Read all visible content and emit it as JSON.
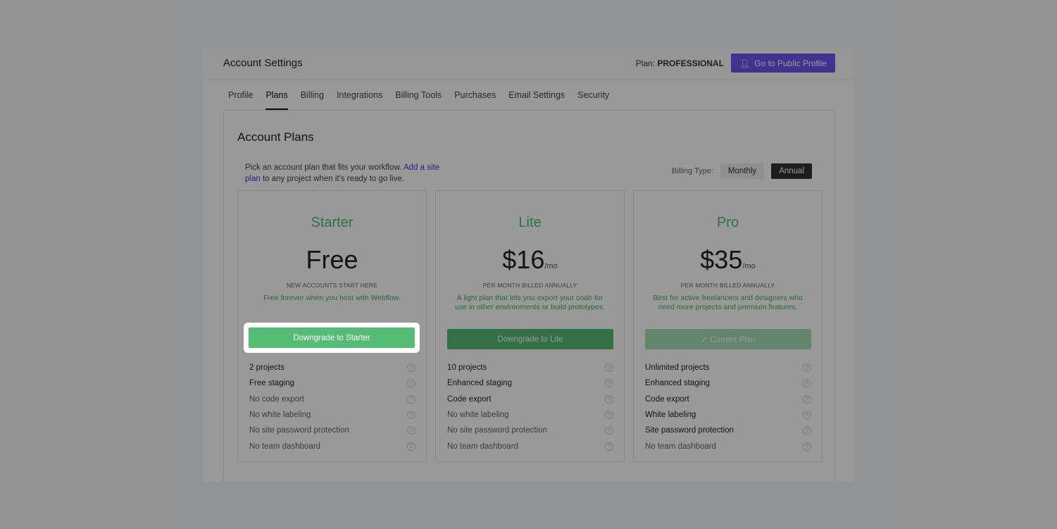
{
  "header": {
    "title": "Account Settings",
    "plan_label": "Plan:",
    "plan_value": "PROFESSIONAL",
    "profile_button": "Go to Public Profile"
  },
  "tabs": [
    "Profile",
    "Plans",
    "Billing",
    "Integrations",
    "Billing Tools",
    "Purchases",
    "Email Settings",
    "Security"
  ],
  "active_tab": "Plans",
  "section": {
    "title": "Account Plans",
    "desc_before": "Pick an account plan that fits your workflow. ",
    "desc_link": "Add a site plan",
    "desc_after": " to any project when it's ready to go live.",
    "billing_label": "Billing Type:",
    "billing_options": [
      "Monthly",
      "Annual"
    ],
    "billing_selected": "Annual"
  },
  "plans": [
    {
      "name": "Starter",
      "price": "Free",
      "unit": "",
      "note": "NEW ACCOUNTS START HERE",
      "tagline": "Free forever when you host with Webflow.",
      "button": "Downgrade to Starter",
      "button_color": "#55bc74",
      "features": [
        [
          "2 projects",
          1
        ],
        [
          "Free staging",
          1
        ],
        [
          "No code export",
          0
        ],
        [
          "No white labeling",
          0
        ],
        [
          "No site password protection",
          0
        ],
        [
          "No team dashboard",
          0
        ]
      ]
    },
    {
      "name": "Lite",
      "price": "$16",
      "unit": "/mo",
      "note": "PER MONTH BILLED ANNUALLY",
      "tagline": "A light plan that lets you export your code for use in other environments or build prototypes.",
      "button": "Downgrade to Lite",
      "button_color": "#55bc74",
      "features": [
        [
          "10 projects",
          1
        ],
        [
          "Enhanced staging",
          1
        ],
        [
          "Code export",
          1
        ],
        [
          "No white labeling",
          0
        ],
        [
          "No site password protection",
          0
        ],
        [
          "No team dashboard",
          0
        ]
      ]
    },
    {
      "name": "Pro",
      "price": "$35",
      "unit": "/mo",
      "note": "PER MONTH BILLED ANNUALLY",
      "tagline": "Best for active freelancers and designers who need more projects and premium features.",
      "button": "✓ Current Plan",
      "button_color": "#a5dcb6",
      "features": [
        [
          "Unlimited projects",
          1
        ],
        [
          "Enhanced staging",
          1
        ],
        [
          "Code export",
          1
        ],
        [
          "White labeling",
          1
        ],
        [
          "Site password protection",
          1
        ],
        [
          "No team dashboard",
          0
        ]
      ]
    }
  ],
  "highlight": "Downgrade to Starter"
}
